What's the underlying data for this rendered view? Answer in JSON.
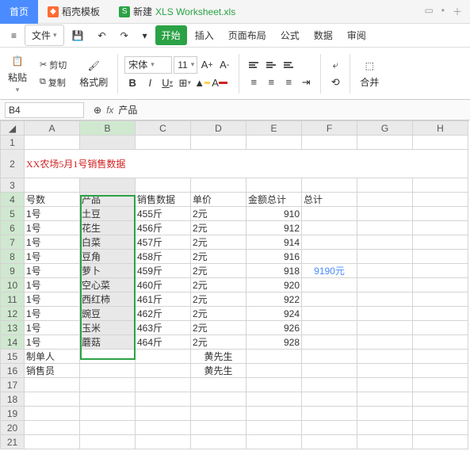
{
  "tabs": {
    "home": "首页",
    "template": "稻壳模板",
    "workbook_prefix": "新建 ",
    "workbook_name": "XLS Worksheet.xls"
  },
  "menu": {
    "file": "文件",
    "begin": "开始",
    "insert": "插入",
    "layout": "页面布局",
    "formula": "公式",
    "data": "数据",
    "review": "审阅"
  },
  "toolbar": {
    "paste": "粘贴",
    "cut": "剪切",
    "copy": "复制",
    "fmtpainter": "格式刷",
    "font": "宋体",
    "size": "11",
    "merge": "合并"
  },
  "namebox": {
    "ref": "B4",
    "fx": "fx",
    "value": "产品"
  },
  "cols": [
    "A",
    "B",
    "C",
    "D",
    "E",
    "F",
    "G",
    "H"
  ],
  "title": "XX农场5月1号销售数据",
  "headers": {
    "a": "号数",
    "b": "产品",
    "c": "销售数据",
    "d": "单价",
    "e": "金额总计",
    "f": "总计"
  },
  "rows": [
    {
      "a": "1号",
      "b": "土豆",
      "c": "455斤",
      "d": "2元",
      "e": "910"
    },
    {
      "a": "1号",
      "b": "花生",
      "c": "456斤",
      "d": "2元",
      "e": "912"
    },
    {
      "a": "1号",
      "b": "白菜",
      "c": "457斤",
      "d": "2元",
      "e": "914"
    },
    {
      "a": "1号",
      "b": "豆角",
      "c": "458斤",
      "d": "2元",
      "e": "916"
    },
    {
      "a": "1号",
      "b": "萝卜",
      "c": "459斤",
      "d": "2元",
      "e": "918"
    },
    {
      "a": "1号",
      "b": "空心菜",
      "c": "460斤",
      "d": "2元",
      "e": "920"
    },
    {
      "a": "1号",
      "b": "西红柿",
      "c": "461斤",
      "d": "2元",
      "e": "922"
    },
    {
      "a": "1号",
      "b": "豌豆",
      "c": "462斤",
      "d": "2元",
      "e": "924"
    },
    {
      "a": "1号",
      "b": "玉米",
      "c": "463斤",
      "d": "2元",
      "e": "926"
    },
    {
      "a": "1号",
      "b": "蘑菇",
      "c": "464斤",
      "d": "2元",
      "e": "928"
    }
  ],
  "total_f": "9190元",
  "footer": {
    "maker_label": "制单人",
    "maker_val": "黄先生",
    "seller_label": "销售员",
    "seller_val": "黄先生"
  }
}
